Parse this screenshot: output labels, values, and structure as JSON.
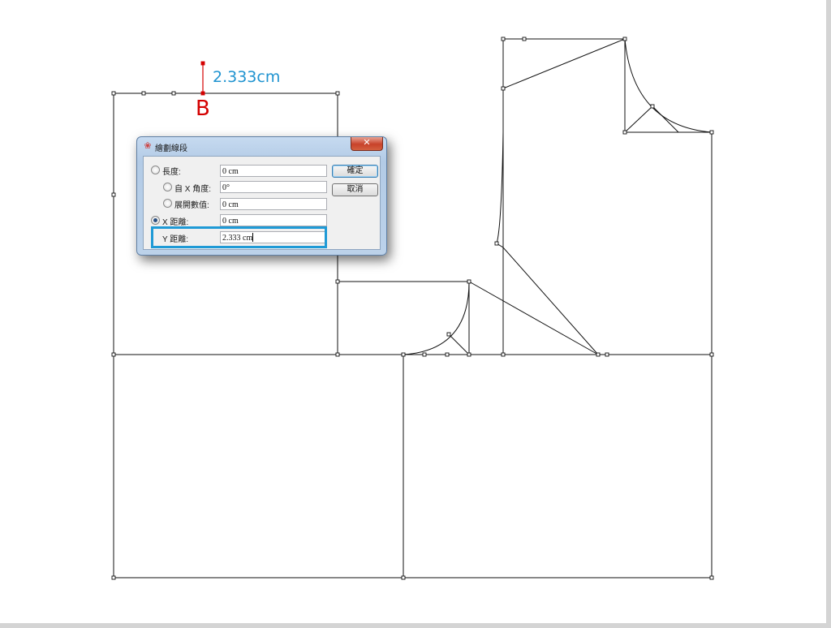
{
  "annotation": {
    "measure_text": "2.333cm",
    "point_label": "B",
    "measure_color": "#1f93d0",
    "point_color": "#d40000",
    "highlight_color": "#1f9ad6"
  },
  "dialog": {
    "title": "繪劃線段",
    "close_glyph": "✕",
    "rows": [
      {
        "label": "長度:",
        "value": "0 cm",
        "radio": true,
        "checked": false
      },
      {
        "label": "自 X 角度:",
        "value": "0°",
        "radio": true,
        "checked": false
      },
      {
        "label": "展開數值:",
        "value": "0 cm",
        "radio": true,
        "checked": false
      },
      {
        "label": "X 距離:",
        "value": "0 cm",
        "radio": true,
        "checked": true
      },
      {
        "label": "Y 距離:",
        "value": "2.333 cm",
        "radio": false,
        "checked": false
      }
    ],
    "ok_label": "確定",
    "cancel_label": "取消"
  },
  "icons": {
    "app": "pattern-app-icon",
    "close": "close-icon"
  }
}
